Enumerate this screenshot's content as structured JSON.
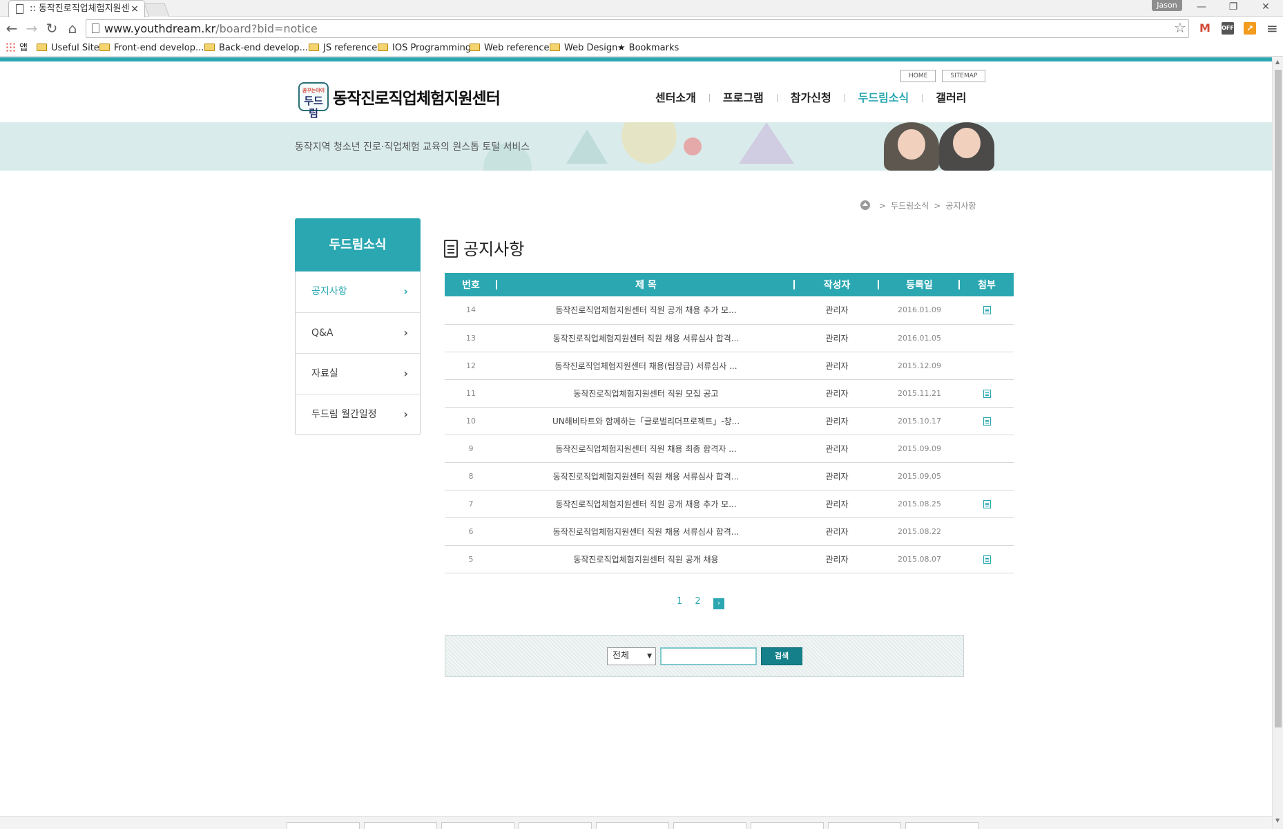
{
  "browser": {
    "tab_title": ":: 동작진로직업체험지원센",
    "tab_close": "×",
    "user": "Jason",
    "url_host": "www.youthdream.kr",
    "url_path": "/board?bid=notice",
    "bookmarks": [
      "앱",
      "Useful Site",
      "Front-end develop...",
      "Back-end develop...",
      "JS reference",
      "IOS Programming",
      "Web reference",
      "Web Design",
      "Bookmarks"
    ],
    "ext_off": "OFF"
  },
  "site": {
    "top_links": [
      "HOME",
      "SITEMAP"
    ],
    "logo_small": "꿈꾸는아이",
    "logo_big": "두드림",
    "logo_text": "동작진로직업체험지원센터",
    "nav": [
      "센터소개",
      "프로그램",
      "참가신청",
      "두드림소식",
      "갤러리"
    ],
    "nav_active_index": 3,
    "banner_text": "동작지역 청소년 진로·직업체험 교육의 원스톱 토털 서비스",
    "accent_color": "#2ba7b1"
  },
  "breadcrumb": [
    "두드림소식",
    "공지사항"
  ],
  "sidebar": {
    "title": "두드림소식",
    "items": [
      "공지사항",
      "Q&A",
      "자료실",
      "두드림 월간일정"
    ],
    "active_index": 0
  },
  "content": {
    "title": "공지사항",
    "columns": [
      "번호",
      "제 목",
      "작성자",
      "등록일",
      "첨부"
    ],
    "rows": [
      {
        "num": "14",
        "subject": "동작진로직업체험지원센터 직원 공개 채용 추가 모...",
        "author": "관리자",
        "date": "2016.01.09",
        "attach": true
      },
      {
        "num": "13",
        "subject": "동작진로직업체험지원센터 직원 채용 서류심사 합격...",
        "author": "관리자",
        "date": "2016.01.05",
        "attach": false
      },
      {
        "num": "12",
        "subject": "동작진로직업체험지원센터 채용(팀장급) 서류심사 ...",
        "author": "관리자",
        "date": "2015.12.09",
        "attach": false
      },
      {
        "num": "11",
        "subject": "동작진로직업체험지원센터 직원 모집 공고",
        "author": "관리자",
        "date": "2015.11.21",
        "attach": true
      },
      {
        "num": "10",
        "subject": "UN해비타트와 함께하는「글로벌리더프로젝트」-창...",
        "author": "관리자",
        "date": "2015.10.17",
        "attach": true
      },
      {
        "num": "9",
        "subject": "동작진로직업체험지원센터 직원 채용 최종 합격자 ...",
        "author": "관리자",
        "date": "2015.09.09",
        "attach": false
      },
      {
        "num": "8",
        "subject": "동작진로직업체험지원센터 직원 채용 서류심사 합격...",
        "author": "관리자",
        "date": "2015.09.05",
        "attach": false
      },
      {
        "num": "7",
        "subject": "동작진로직업체험지원센터 직원 공개 채용 추가 모...",
        "author": "관리자",
        "date": "2015.08.25",
        "attach": true
      },
      {
        "num": "6",
        "subject": "동작진로직업체험지원센터 직원 채용 서류심사 합격...",
        "author": "관리자",
        "date": "2015.08.22",
        "attach": false
      },
      {
        "num": "5",
        "subject": "동작진로직업체험지원센터 직원 공개 채용",
        "author": "관리자",
        "date": "2015.08.07",
        "attach": true
      }
    ],
    "pages": [
      "1",
      "2"
    ],
    "next_label": "›"
  },
  "search": {
    "select_value": "전체",
    "input_value": "",
    "button_label": "검색"
  }
}
